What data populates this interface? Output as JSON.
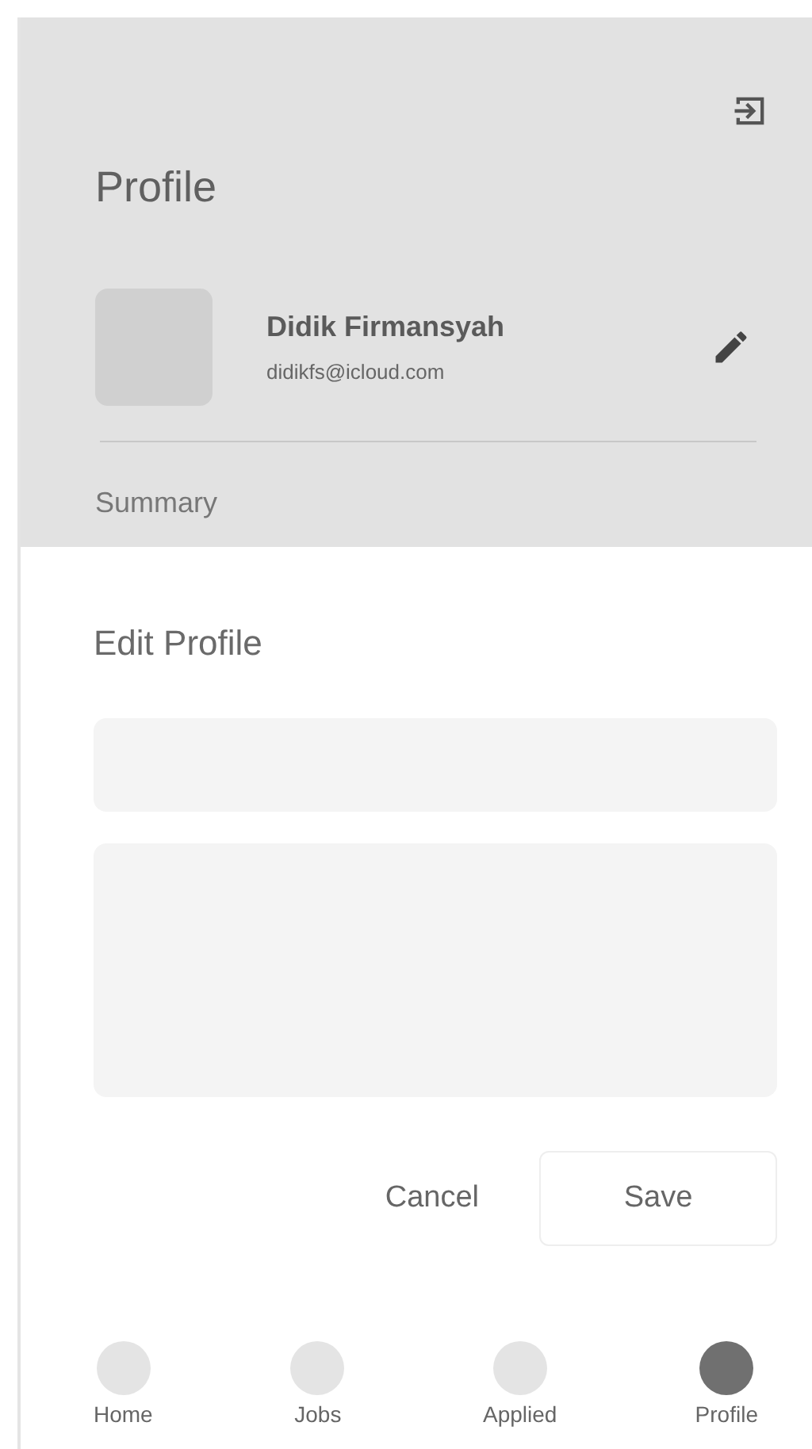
{
  "header": {
    "title": "Profile"
  },
  "user": {
    "name": "Didik Firmansyah",
    "email": "didikfs@icloud.com"
  },
  "summary_label": "Summary",
  "edit_sheet": {
    "title": "Edit Profile",
    "fields": [
      {
        "kind": "input"
      },
      {
        "kind": "textarea"
      }
    ],
    "buttons": [
      {
        "label": "Cancel",
        "kind": "text"
      },
      {
        "label": "Save",
        "kind": "outlined"
      }
    ]
  },
  "nav": [
    {
      "label": "Home",
      "selected": false
    },
    {
      "label": "Jobs",
      "selected": false
    },
    {
      "label": "Applied",
      "selected": false
    },
    {
      "label": "Profile",
      "selected": true
    }
  ]
}
